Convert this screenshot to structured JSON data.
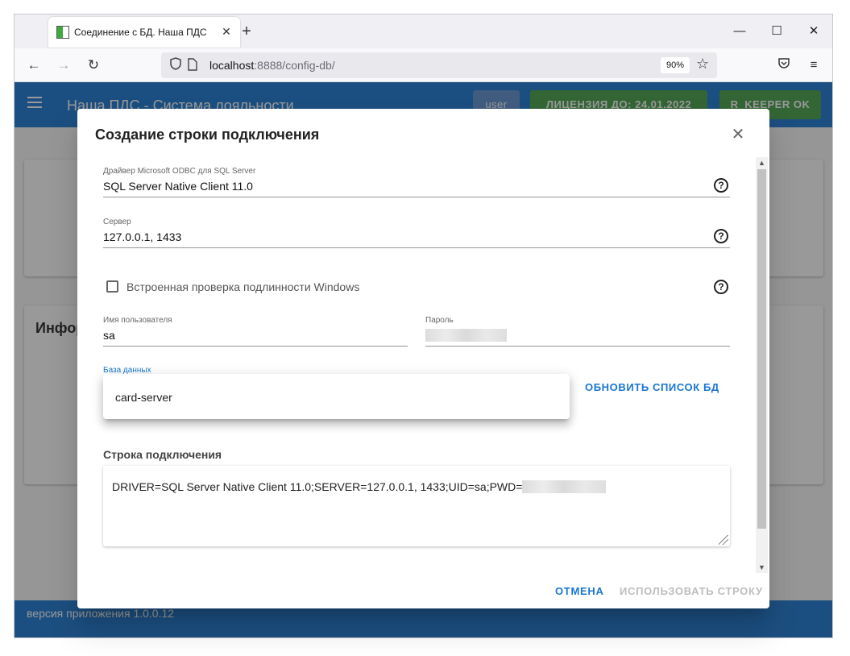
{
  "browser": {
    "tab_title": "Соединение с БД. Наша ПДС",
    "tab_close": "✕",
    "new_tab": "+",
    "url_host": "localhost",
    "url_rest": ":8888/config-db/",
    "zoom": "90%",
    "back_icon": "arrow-left-icon",
    "forward_icon": "arrow-right-icon",
    "reload_icon": "reload-icon"
  },
  "app": {
    "title": "Наша ПДС - Система лояльности",
    "user_button": "user",
    "license_button": "ЛИЦЕНЗИЯ ДО: 24.01.2022",
    "keeper_button": "R_KEEPER OK",
    "info_card_title": "Инфор",
    "footer_version": "версия приложения 1.0.0.12",
    "colors": {
      "primary": "#1976d2",
      "success": "#43a047"
    }
  },
  "dialog": {
    "title": "Создание строки подключения",
    "driver_label": "Драйвер Microsoft ODBC для SQL Server",
    "driver_value": "SQL Server Native Client 11.0",
    "server_label": "Сервер",
    "server_value": "127.0.0.1, 1433",
    "windows_auth_label": "Встроенная проверка подлинности Windows",
    "windows_auth_checked": false,
    "username_label": "Имя пользователя",
    "username_value": "sa",
    "password_label": "Пароль",
    "database_label": "База данных",
    "database_options": [
      "card-server"
    ],
    "refresh_button": "ОБНОВИТЬ СПИСОК БД",
    "connection_heading": "Строка подключения",
    "connection_string": "DRIVER=SQL Server Native Client 11.0;SERVER=127.0.0.1, 1433;UID=sa;PWD=",
    "cancel_button": "ОТМЕНА",
    "use_button": "ИСПОЛЬЗОВАТЬ СТРОКУ",
    "help_glyph": "?"
  }
}
